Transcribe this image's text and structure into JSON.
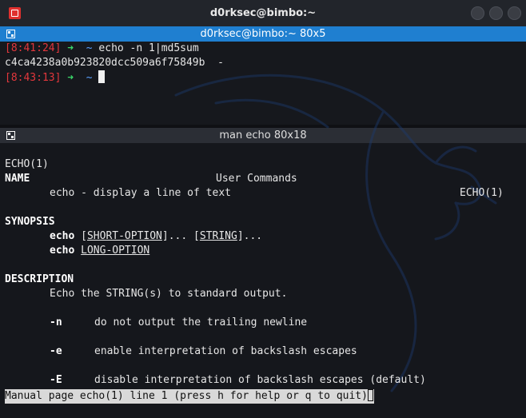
{
  "window": {
    "title": "d0rksec@bimbo:~"
  },
  "pane_top": {
    "header": "d0rksec@bimbo:~ 80x5",
    "line1": {
      "time": "[8:41:24]",
      "arrow": "➜",
      "dir": "~",
      "command": "echo -n 1|md5sum"
    },
    "output": "c4ca4238a0b923820dcc509a6f75849b  -",
    "line3": {
      "time": "[8:43:13]",
      "arrow": "➜",
      "dir": "~"
    }
  },
  "pane_bottom": {
    "header": "man echo 80x18",
    "head_left": "ECHO(1)",
    "head_center": "User Commands",
    "head_right": "ECHO(1)",
    "name_heading": "NAME",
    "name_text": "echo - display a line of text",
    "synopsis_heading": "SYNOPSIS",
    "syn1_cmd": "echo",
    "syn1_open": "[",
    "syn1_short": "SHORT-OPTION",
    "syn1_mid": "]... [",
    "syn1_string": "STRING",
    "syn1_close": "]...",
    "syn2_cmd": "echo",
    "syn2_long": "LONG-OPTION",
    "description_heading": "DESCRIPTION",
    "desc_text": "Echo the STRING(s) to standard output.",
    "opt_n_flag": "-n",
    "opt_n_text": "do not output the trailing newline",
    "opt_e_flag": "-e",
    "opt_e_text": "enable interpretation of backslash escapes",
    "opt_E_flag": "-E",
    "opt_E_text": "disable interpretation of backslash escapes (default)",
    "status": "Manual page echo(1) line 1 (press h for help or q to quit)"
  },
  "colors": {
    "accent_blue": "#1f7fd0",
    "prompt_red": "#e3373c",
    "prompt_green": "#3bd96a",
    "prompt_blue": "#5aa0ff"
  }
}
